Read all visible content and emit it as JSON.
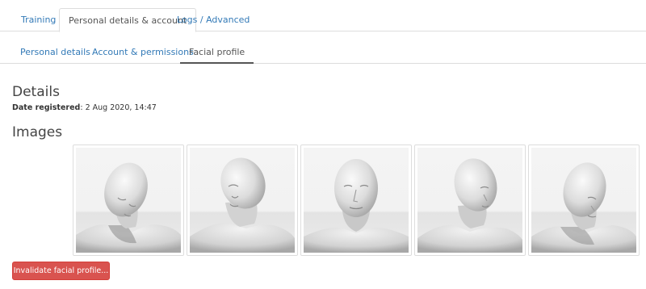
{
  "tabs": [
    {
      "label": "Training",
      "active": false
    },
    {
      "label": "Personal details & account",
      "active": true
    },
    {
      "label": "Logs / Advanced",
      "active": false
    }
  ],
  "subtabs": [
    {
      "label": "Personal details",
      "active": false
    },
    {
      "label": "Account & permissions",
      "active": false
    },
    {
      "label": "Facial profile",
      "active": true
    }
  ],
  "details": {
    "heading": "Details",
    "date_label": "Date registered",
    "date_value": ": 2 Aug 2020, 14:47"
  },
  "images": {
    "heading": "Images",
    "count": 5
  },
  "colors": {
    "link": "#337ab7",
    "active_text": "#555555",
    "danger": "#d9534f"
  },
  "actions": {
    "invalidate_label": "Invalidate facial profile..."
  }
}
